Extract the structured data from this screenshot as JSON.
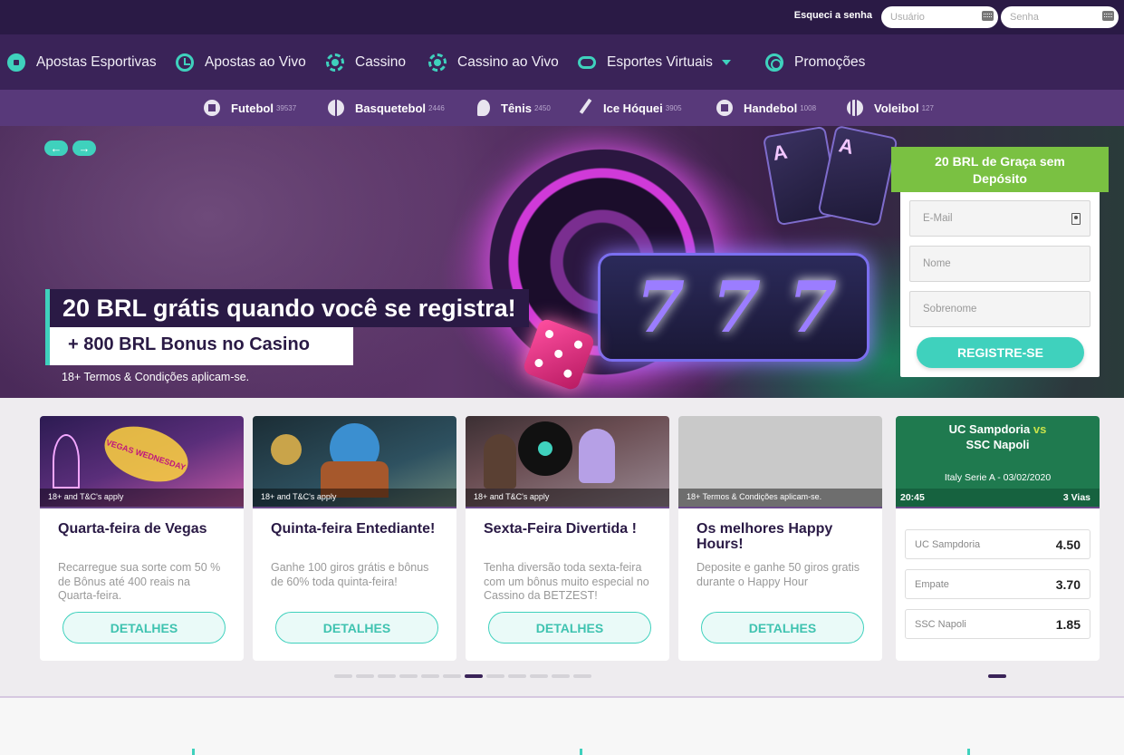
{
  "topbar": {
    "forgot_password": "Esqueci a senha",
    "username_placeholder": "Usuário",
    "password_placeholder": "Senha"
  },
  "mainnav": {
    "items": [
      {
        "label": "Apostas Esportivas",
        "icon": "soccer-ball-icon"
      },
      {
        "label": "Apostas ao Vivo",
        "icon": "clock-icon"
      },
      {
        "label": "Cassino",
        "icon": "casino-chip-icon"
      },
      {
        "label": "Cassino ao Vivo",
        "icon": "live-casino-icon"
      },
      {
        "label": "Esportes Virtuais",
        "icon": "gamepad-icon"
      },
      {
        "label": "Promoções",
        "icon": "promo-gift-icon"
      }
    ]
  },
  "sports": {
    "items": [
      {
        "label": "Futebol",
        "count": "39537"
      },
      {
        "label": "Basquetebol",
        "count": "2446"
      },
      {
        "label": "Tênis",
        "count": "2450"
      },
      {
        "label": "Ice Hóquei",
        "count": "3905"
      },
      {
        "label": "Handebol",
        "count": "1008"
      },
      {
        "label": "Voleibol",
        "count": "127"
      }
    ]
  },
  "hero": {
    "prev": "←",
    "next": "→",
    "headline": "20 BRL grátis quando você se registra!",
    "subheadline": "+ 800 BRL Bonus no Casino",
    "terms": "18+ Termos & Condições aplicam-se.",
    "reels": [
      "7",
      "7",
      "7"
    ],
    "cards": [
      "A",
      "A"
    ]
  },
  "register": {
    "title": "20 BRL de Graça sem Depósito",
    "email_placeholder": "E-Mail",
    "name_placeholder": "Nome",
    "surname_placeholder": "Sobrenome",
    "button": "REGISTRE-SE"
  },
  "promos": [
    {
      "badge": "18+ and T&C's apply",
      "title": "Quarta-feira de Vegas",
      "desc": "Recarregue sua sorte com 50 % de Bônus até 400 reais na Quarta-feira.",
      "button": "DETALHES",
      "sign": "VEGAS WEDNESDAY"
    },
    {
      "badge": "18+ and T&C's apply",
      "title": "Quinta-feira Entediante!",
      "desc": "Ganhe 100 giros grátis e bônus de 60% toda quinta-feira!",
      "button": "DETALHES"
    },
    {
      "badge": "18+ and T&C's apply",
      "title": "Sexta-Feira Divertida !",
      "desc": "Tenha diversão toda sexta-feira com um bônus muito especial no Cassino da BETZEST!",
      "button": "DETALHES"
    },
    {
      "badge": "18+ Termos & Condições aplicam-se.",
      "title": "Os melhores Happy Hours!",
      "desc": "Deposite e ganhe 50 giros gratis durante o Happy Hour",
      "button": "DETALHES"
    }
  ],
  "match": {
    "home": "UC Sampdoria",
    "vs": "vs",
    "away": "SSC Napoli",
    "league": "Italy Serie A - 03/02/2020",
    "time": "20:45",
    "ways": "3 Vias",
    "odds": [
      {
        "label": "UC Sampdoria",
        "value": "4.50"
      },
      {
        "label": "Empate",
        "value": "3.70"
      },
      {
        "label": "SSC Napoli",
        "value": "1.85"
      }
    ]
  },
  "carousel": {
    "total_dots": 12,
    "active_dot": 7
  },
  "colors": {
    "accent": "#3fd1bd",
    "nav_dark": "#2a1a45",
    "nav": "#3a2358",
    "sportsbar": "#58397a",
    "green": "#7ac142",
    "match_green": "#1f7a4f"
  }
}
